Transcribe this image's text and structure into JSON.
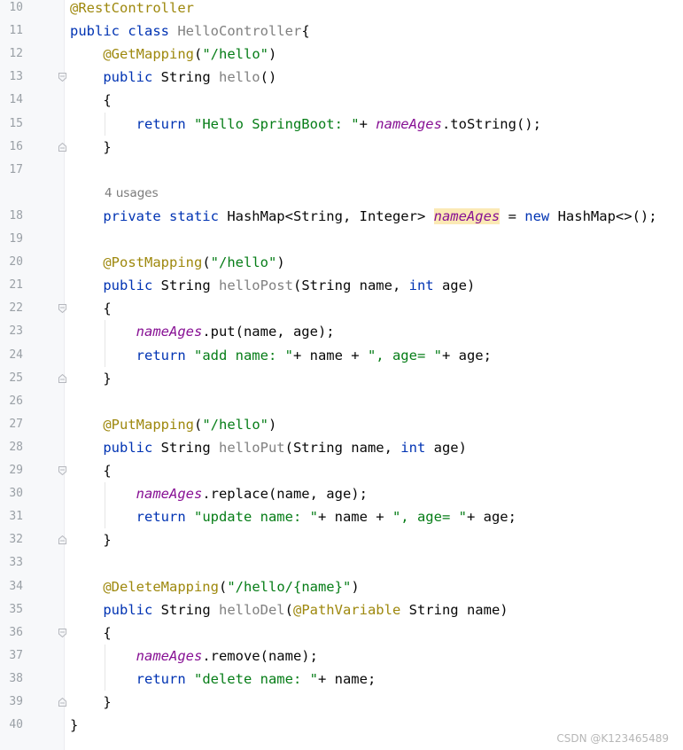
{
  "editor": {
    "gutter": [
      {
        "ln": "10",
        "fold": ""
      },
      {
        "ln": "11",
        "fold": ""
      },
      {
        "ln": "12",
        "fold": ""
      },
      {
        "ln": "13",
        "fold": "open"
      },
      {
        "ln": "14",
        "fold": ""
      },
      {
        "ln": "15",
        "fold": ""
      },
      {
        "ln": "16",
        "fold": "close"
      },
      {
        "ln": "17",
        "fold": ""
      },
      {
        "ln": "",
        "fold": ""
      },
      {
        "ln": "18",
        "fold": ""
      },
      {
        "ln": "19",
        "fold": ""
      },
      {
        "ln": "20",
        "fold": ""
      },
      {
        "ln": "21",
        "fold": ""
      },
      {
        "ln": "22",
        "fold": "open"
      },
      {
        "ln": "23",
        "fold": ""
      },
      {
        "ln": "24",
        "fold": ""
      },
      {
        "ln": "25",
        "fold": "close"
      },
      {
        "ln": "26",
        "fold": ""
      },
      {
        "ln": "27",
        "fold": ""
      },
      {
        "ln": "28",
        "fold": ""
      },
      {
        "ln": "29",
        "fold": "open"
      },
      {
        "ln": "30",
        "fold": ""
      },
      {
        "ln": "31",
        "fold": ""
      },
      {
        "ln": "32",
        "fold": "close"
      },
      {
        "ln": "33",
        "fold": ""
      },
      {
        "ln": "34",
        "fold": ""
      },
      {
        "ln": "35",
        "fold": ""
      },
      {
        "ln": "36",
        "fold": "open"
      },
      {
        "ln": "37",
        "fold": ""
      },
      {
        "ln": "38",
        "fold": ""
      },
      {
        "ln": "39",
        "fold": "close"
      },
      {
        "ln": "40",
        "fold": ""
      }
    ],
    "code": [
      [
        [
          "ann",
          "@RestController"
        ]
      ],
      [
        [
          "kw",
          "public class "
        ],
        [
          "gry",
          "HelloController"
        ],
        [
          "",
          "{"
        ]
      ],
      [
        [
          "ann",
          "    @GetMapping"
        ],
        [
          "",
          "("
        ],
        [
          "str",
          "\"/hello\""
        ],
        [
          "",
          ")"
        ]
      ],
      [
        [
          "kw",
          "    public "
        ],
        [
          "",
          "String "
        ],
        [
          "gry",
          "hello"
        ],
        [
          "",
          "()"
        ]
      ],
      [
        [
          "",
          "    {"
        ]
      ],
      [
        [
          "kw",
          "        return "
        ],
        [
          "str",
          "\"Hello SpringBoot: \""
        ],
        [
          "",
          "+ "
        ],
        [
          "fld",
          "nameAges"
        ],
        [
          "",
          ".toString();"
        ]
      ],
      [
        [
          "",
          "    }"
        ]
      ],
      [
        [
          "",
          ""
        ]
      ],
      [
        [
          "usages",
          "4 usages"
        ]
      ],
      [
        [
          "kw",
          "    private static "
        ],
        [
          "",
          "HashMap<String, Integer> "
        ],
        [
          "fld hl",
          "nameAges"
        ],
        [
          "",
          " = "
        ],
        [
          "kw",
          "new "
        ],
        [
          "",
          "HashMap<>();"
        ]
      ],
      [
        [
          "",
          ""
        ]
      ],
      [
        [
          "ann",
          "    @PostMapping"
        ],
        [
          "",
          "("
        ],
        [
          "str",
          "\"/hello\""
        ],
        [
          "",
          ")"
        ]
      ],
      [
        [
          "kw",
          "    public "
        ],
        [
          "",
          "String "
        ],
        [
          "gry",
          "helloPost"
        ],
        [
          "",
          "(String name, "
        ],
        [
          "kw",
          "int "
        ],
        [
          "",
          "age)"
        ]
      ],
      [
        [
          "",
          "    {"
        ]
      ],
      [
        [
          "fld",
          "        nameAges"
        ],
        [
          "",
          ".put(name, age);"
        ]
      ],
      [
        [
          "kw",
          "        return "
        ],
        [
          "str",
          "\"add name: \""
        ],
        [
          "",
          "+ name + "
        ],
        [
          "str",
          "\", age= \""
        ],
        [
          "",
          "+ age;"
        ]
      ],
      [
        [
          "",
          "    }"
        ]
      ],
      [
        [
          "",
          ""
        ]
      ],
      [
        [
          "ann",
          "    @PutMapping"
        ],
        [
          "",
          "("
        ],
        [
          "str",
          "\"/hello\""
        ],
        [
          "",
          ")"
        ]
      ],
      [
        [
          "kw",
          "    public "
        ],
        [
          "",
          "String "
        ],
        [
          "gry",
          "helloPut"
        ],
        [
          "",
          "(String name, "
        ],
        [
          "kw",
          "int "
        ],
        [
          "",
          "age)"
        ]
      ],
      [
        [
          "",
          "    {"
        ]
      ],
      [
        [
          "fld",
          "        nameAges"
        ],
        [
          "",
          ".replace(name, age);"
        ]
      ],
      [
        [
          "kw",
          "        return "
        ],
        [
          "str",
          "\"update name: \""
        ],
        [
          "",
          "+ name + "
        ],
        [
          "str",
          "\", age= \""
        ],
        [
          "",
          "+ age;"
        ]
      ],
      [
        [
          "",
          "    }"
        ]
      ],
      [
        [
          "",
          ""
        ]
      ],
      [
        [
          "ann",
          "    @DeleteMapping"
        ],
        [
          "",
          "("
        ],
        [
          "str",
          "\"/hello/{name}\""
        ],
        [
          "",
          ")"
        ]
      ],
      [
        [
          "kw",
          "    public "
        ],
        [
          "",
          "String "
        ],
        [
          "gry",
          "helloDel"
        ],
        [
          "",
          "("
        ],
        [
          "ann",
          "@PathVariable "
        ],
        [
          "",
          "String name)"
        ]
      ],
      [
        [
          "",
          "    {"
        ]
      ],
      [
        [
          "fld",
          "        nameAges"
        ],
        [
          "",
          ".remove(name);"
        ]
      ],
      [
        [
          "kw",
          "        return "
        ],
        [
          "str",
          "\"delete name: \""
        ],
        [
          "",
          "+ name;"
        ]
      ],
      [
        [
          "",
          "    }"
        ]
      ],
      [
        [
          "",
          "}"
        ]
      ]
    ],
    "watermark": "CSDN @K123465489"
  }
}
